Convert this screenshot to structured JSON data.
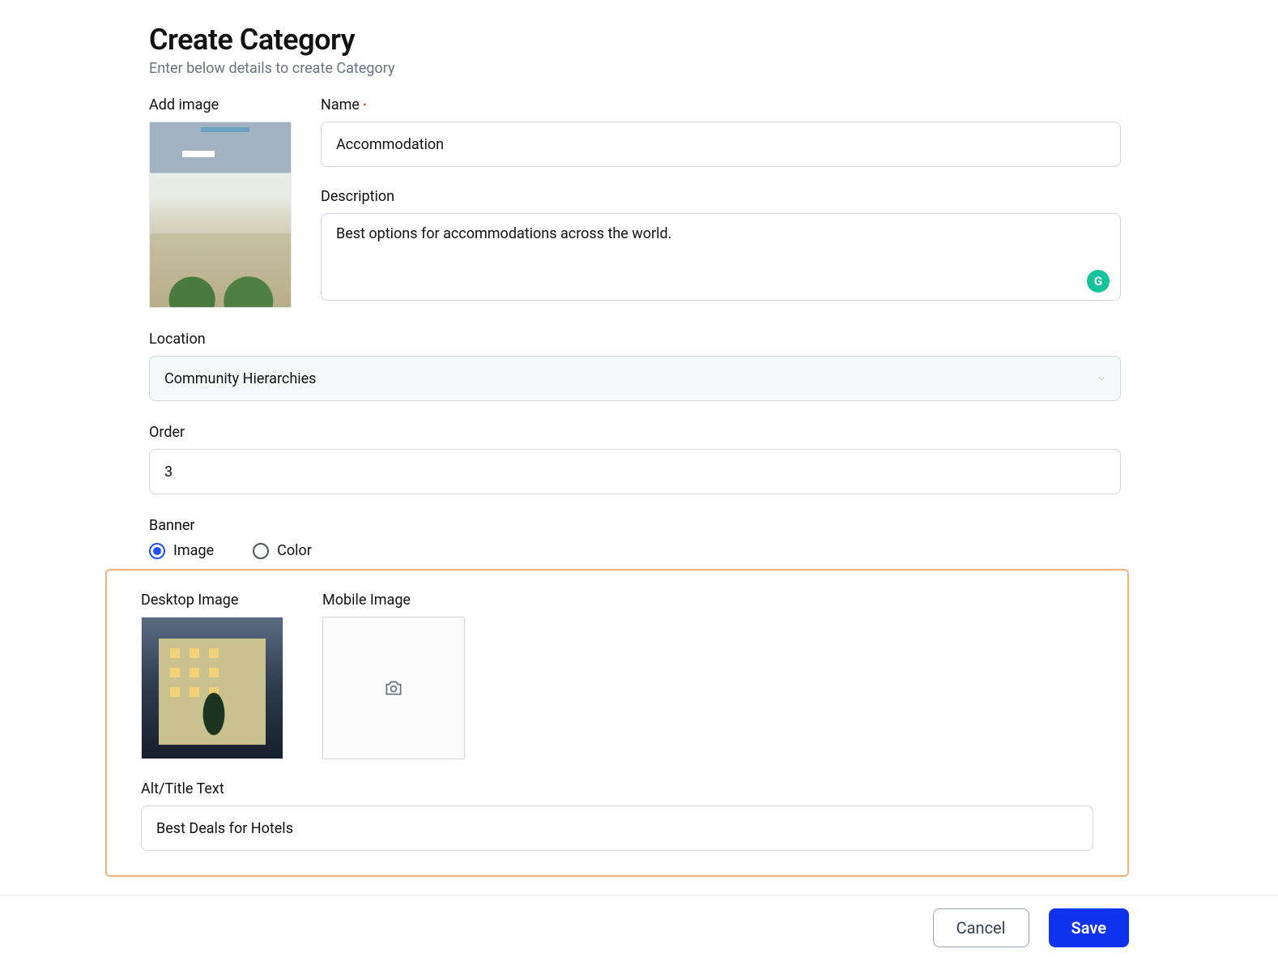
{
  "header": {
    "title": "Create Category",
    "subtitle": "Enter below details to create Category"
  },
  "fields": {
    "add_image_label": "Add image",
    "name_label": "Name",
    "name_value": "Accommodation",
    "description_label": "Description",
    "description_value": "Best options for accommodations across the world.",
    "location_label": "Location",
    "location_value": "Community Hierarchies",
    "order_label": "Order",
    "order_value": "3",
    "banner_label": "Banner",
    "banner_options": {
      "image": "Image",
      "color": "Color"
    },
    "banner_selected": "image",
    "desktop_image_label": "Desktop Image",
    "mobile_image_label": "Mobile Image",
    "alt_label": "Alt/Title Text",
    "alt_value": "Best Deals for Hotels"
  },
  "buttons": {
    "cancel": "Cancel",
    "save": "Save"
  },
  "grammarly_badge": "G"
}
